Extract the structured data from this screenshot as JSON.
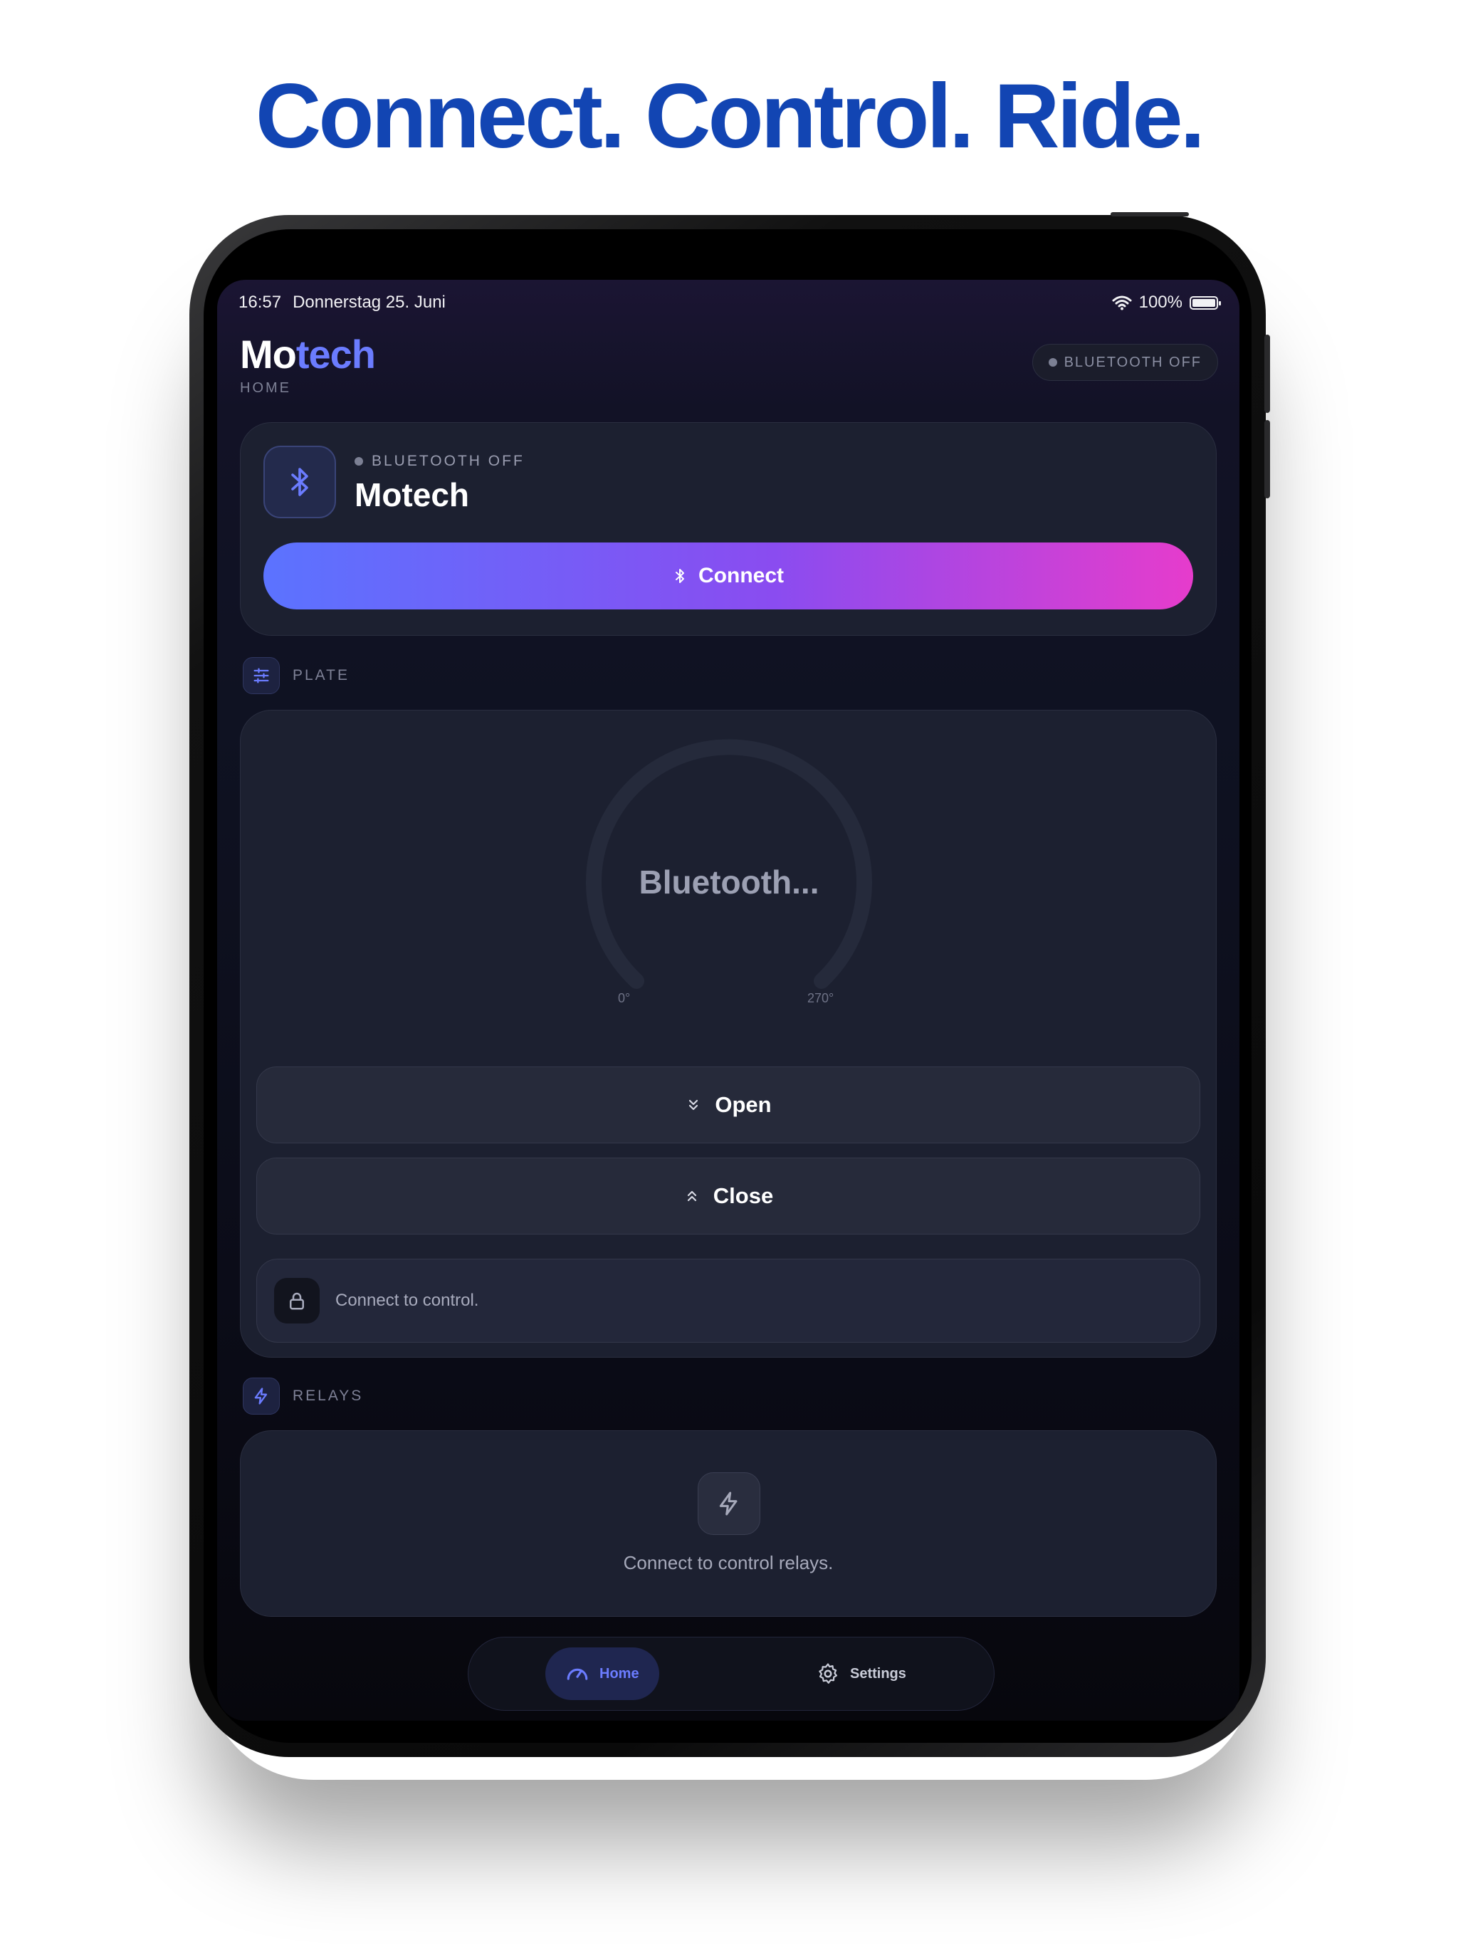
{
  "headline": "Connect. Control. Ride.",
  "status_bar": {
    "time": "16:57",
    "date": "Donnerstag 25. Juni",
    "battery": "100%",
    "icons": [
      "wifi-icon",
      "battery-icon"
    ]
  },
  "header": {
    "title_part1": "Mo",
    "title_part2": "tech",
    "subtitle": "HOME",
    "status_pill": "BLUETOOTH OFF"
  },
  "device_card": {
    "status": "BLUETOOTH OFF",
    "name": "Motech",
    "connect_label": "Connect",
    "icon": "bluetooth-icon"
  },
  "plate": {
    "section_label": "PLATE",
    "gauge_label": "Bluetooth...",
    "gauge_min": "0°",
    "gauge_max": "270°",
    "open_label": "Open",
    "close_label": "Close",
    "lock_message": "Connect to control."
  },
  "relays": {
    "section_label": "RELAYS",
    "message": "Connect to control relays."
  },
  "tabbar": {
    "home_label": "Home",
    "settings_label": "Settings"
  },
  "colors": {
    "headline": "#1245b3",
    "accent": "#6b7cff",
    "gradient_start": "#5b73ff",
    "gradient_end": "#e63ccc",
    "background": "#0f1222"
  }
}
